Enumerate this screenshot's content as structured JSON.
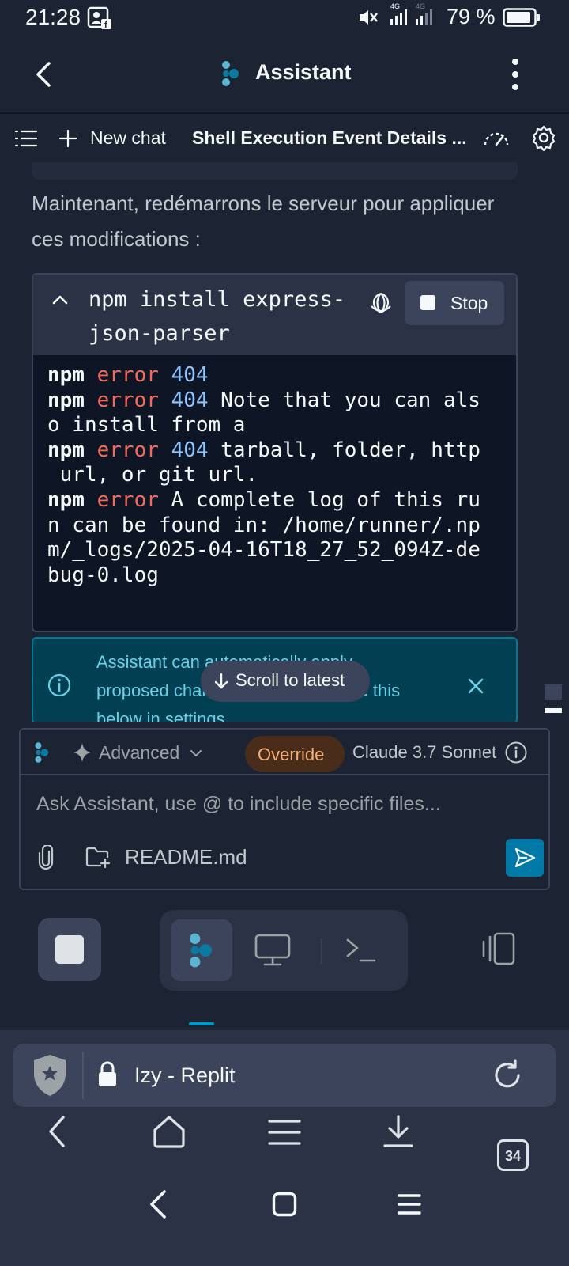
{
  "status_bar": {
    "time": "21:28",
    "network_label": "4G",
    "battery_text": "79 %"
  },
  "header": {
    "title": "Assistant"
  },
  "toolbar": {
    "new_chat_label": "New chat",
    "chat_title": "Shell Execution Event Details ..."
  },
  "chat": {
    "message_text": "Maintenant, redémarrons le serveur pour appliquer ces modifications :",
    "terminal": {
      "command": "npm install express-json-parser",
      "stop_label": "Stop",
      "output_lines": [
        {
          "npm": "npm",
          "err": "error",
          "code": "404",
          "rest": ""
        },
        {
          "npm": "npm",
          "err": "error",
          "code": "404",
          "rest": " Note that you can als\no install from a"
        },
        {
          "npm": "npm",
          "err": "error",
          "code": "404",
          "rest": " tarball, folder, http\n url, or git url."
        },
        {
          "npm": "npm",
          "err": "error",
          "code": "",
          "rest": " A complete log of this ru\nn can be found in: /home/runner/.np\nm/_logs/2025-04-16T18_27_52_094Z-de\nbug-0.log"
        }
      ]
    },
    "banner_text": "Assistant can automatically apply proposed changes. You can enable this below in settings.",
    "scroll_to_latest": "Scroll to latest"
  },
  "composer": {
    "mode_label": "Advanced",
    "override_label": "Override",
    "model_label": "Claude 3.7 Sonnet",
    "placeholder": "Ask Assistant, use @ to include specific files...",
    "attached_file": "README.md"
  },
  "browser": {
    "page_title": "Izy - Replit",
    "tab_count": "34"
  },
  "colors": {
    "background": "#1c2333",
    "surface": "#2b3245",
    "accent": "#0079a8",
    "error_red": "#f26b5b",
    "code_blue": "#8ec5ff",
    "override_orange": "#f5b07a"
  }
}
